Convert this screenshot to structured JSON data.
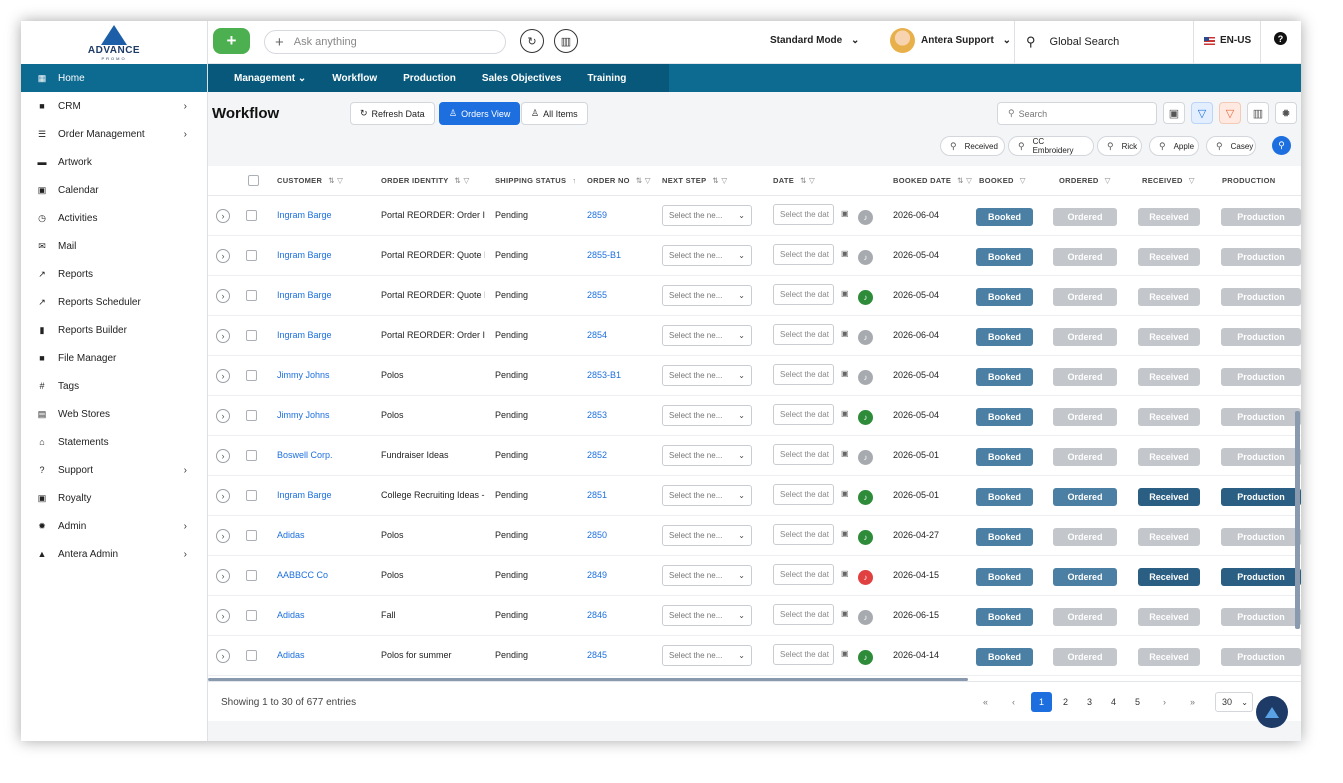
{
  "brand": {
    "logo_text": "ADVANCE",
    "logo_sub": "PROMO"
  },
  "sidebar": {
    "items": [
      {
        "label": "Home",
        "icon": "grid-icon",
        "glyph": "▦",
        "arrow": false,
        "active": true
      },
      {
        "label": "CRM",
        "icon": "briefcase-icon",
        "glyph": "■",
        "arrow": true
      },
      {
        "label": "Order Management",
        "icon": "list-icon",
        "glyph": "☰",
        "arrow": true
      },
      {
        "label": "Artwork",
        "icon": "artwork-icon",
        "glyph": "▬",
        "arrow": false
      },
      {
        "label": "Calendar",
        "icon": "calendar-icon",
        "glyph": "▣",
        "arrow": false
      },
      {
        "label": "Activities",
        "icon": "clock-icon",
        "glyph": "◷",
        "arrow": false
      },
      {
        "label": "Mail",
        "icon": "mail-icon",
        "glyph": "✉",
        "arrow": false
      },
      {
        "label": "Reports",
        "icon": "trend-icon",
        "glyph": "↗",
        "arrow": false
      },
      {
        "label": "Reports Scheduler",
        "icon": "trend-icon",
        "glyph": "↗",
        "arrow": false
      },
      {
        "label": "Reports Builder",
        "icon": "bar-chart-icon",
        "glyph": "▮",
        "arrow": false
      },
      {
        "label": "File Manager",
        "icon": "folder-icon",
        "glyph": "■",
        "arrow": false
      },
      {
        "label": "Tags",
        "icon": "hash-icon",
        "glyph": "#",
        "arrow": false
      },
      {
        "label": "Web Stores",
        "icon": "store-icon",
        "glyph": "▤",
        "arrow": false
      },
      {
        "label": "Statements",
        "icon": "bank-icon",
        "glyph": "⌂",
        "arrow": false
      },
      {
        "label": "Support",
        "icon": "help-circle-icon",
        "glyph": "?",
        "arrow": true
      },
      {
        "label": "Royalty",
        "icon": "calendar-icon",
        "glyph": "▣",
        "arrow": false
      },
      {
        "label": "Admin",
        "icon": "gear-icon",
        "glyph": "✹",
        "arrow": true
      },
      {
        "label": "Antera Admin",
        "icon": "lock-icon",
        "glyph": "▲",
        "arrow": true
      }
    ]
  },
  "topbar": {
    "ask_placeholder": "Ask anything",
    "mode": "Standard Mode",
    "user": "Antera Support",
    "global_search": "Global Search",
    "lang": "EN-US",
    "help": "?"
  },
  "nav": {
    "items": [
      "Management",
      "Workflow",
      "Production",
      "Sales Objectives",
      "Training"
    ]
  },
  "page": {
    "title": "Workflow",
    "refresh": "Refresh Data",
    "orders_view": "Orders View",
    "all_items": "All Items",
    "search_placeholder": "Search"
  },
  "chips": [
    "Received",
    "CC Embroidery",
    "Rick",
    "Apple",
    "Casey"
  ],
  "table": {
    "columns": [
      "CUSTOMER",
      "ORDER IDENTITY",
      "SHIPPING STATUS",
      "ORDER NO",
      "NEXT STEP",
      "DATE",
      "BOOKED DATE",
      "BOOKED",
      "ORDERED",
      "RECEIVED",
      "PRODUCTION"
    ],
    "next_step_placeholder": "Select the ne...",
    "date_placeholder": "Select the dat",
    "status_labels": {
      "booked": "Booked",
      "ordered": "Ordered",
      "received": "Received",
      "production": "Production"
    },
    "rows": [
      {
        "customer": "Ingram Barge",
        "identity": "Portal REORDER: Order Id",
        "shipping": "Pending",
        "order_no": "2859",
        "bell": "grey",
        "booked_date": "2026-06-04",
        "ordered": false,
        "received": false,
        "production": false
      },
      {
        "customer": "Ingram Barge",
        "identity": "Portal REORDER: Quote Ic",
        "shipping": "Pending",
        "order_no": "2855-B1",
        "bell": "grey",
        "booked_date": "2026-05-04",
        "ordered": false,
        "received": false,
        "production": false
      },
      {
        "customer": "Ingram Barge",
        "identity": "Portal REORDER: Quote Ic",
        "shipping": "Pending",
        "order_no": "2855",
        "bell": "green",
        "booked_date": "2026-05-04",
        "ordered": false,
        "received": false,
        "production": false
      },
      {
        "customer": "Ingram Barge",
        "identity": "Portal REORDER: Order Id",
        "shipping": "Pending",
        "order_no": "2854",
        "bell": "grey",
        "booked_date": "2026-06-04",
        "ordered": false,
        "received": false,
        "production": false
      },
      {
        "customer": "Jimmy Johns",
        "identity": "Polos",
        "shipping": "Pending",
        "order_no": "2853-B1",
        "bell": "grey",
        "booked_date": "2026-05-04",
        "ordered": false,
        "received": false,
        "production": false
      },
      {
        "customer": "Jimmy Johns",
        "identity": "Polos",
        "shipping": "Pending",
        "order_no": "2853",
        "bell": "green",
        "booked_date": "2026-05-04",
        "ordered": false,
        "received": false,
        "production": false
      },
      {
        "customer": "Boswell Corp.",
        "identity": "Fundraiser Ideas",
        "shipping": "Pending",
        "order_no": "2852",
        "bell": "grey",
        "booked_date": "2026-05-01",
        "ordered": false,
        "received": false,
        "production": false
      },
      {
        "customer": "Ingram Barge",
        "identity": "College Recruiting Ideas -",
        "shipping": "Pending",
        "order_no": "2851",
        "bell": "green",
        "booked_date": "2026-05-01",
        "ordered": true,
        "received": true,
        "production": true
      },
      {
        "customer": "Adidas",
        "identity": "Polos",
        "shipping": "Pending",
        "order_no": "2850",
        "bell": "green",
        "booked_date": "2026-04-27",
        "ordered": false,
        "received": false,
        "production": false
      },
      {
        "customer": "AABBCC Co",
        "identity": "Polos",
        "shipping": "Pending",
        "order_no": "2849",
        "bell": "red",
        "booked_date": "2026-04-15",
        "ordered": true,
        "received": true,
        "production": true
      },
      {
        "customer": "Adidas",
        "identity": "Fall",
        "shipping": "Pending",
        "order_no": "2846",
        "bell": "grey",
        "booked_date": "2026-06-15",
        "ordered": false,
        "received": false,
        "production": false
      },
      {
        "customer": "Adidas",
        "identity": "Polos for summer",
        "shipping": "Pending",
        "order_no": "2845",
        "bell": "green",
        "booked_date": "2026-04-14",
        "ordered": false,
        "received": false,
        "production": false
      }
    ]
  },
  "footer": {
    "entries": "Showing 1 to 30 of 677 entries",
    "pages": [
      "1",
      "2",
      "3",
      "4",
      "5"
    ],
    "first": "«",
    "prev": "‹",
    "next": "›",
    "last": "»",
    "per_page": "30"
  },
  "colors": {
    "nav": "#0d6a91",
    "primary": "#1d6fe0",
    "plus": "#4caf50",
    "booked": "#4b7fa3",
    "inactive": "#c3c6ca"
  }
}
